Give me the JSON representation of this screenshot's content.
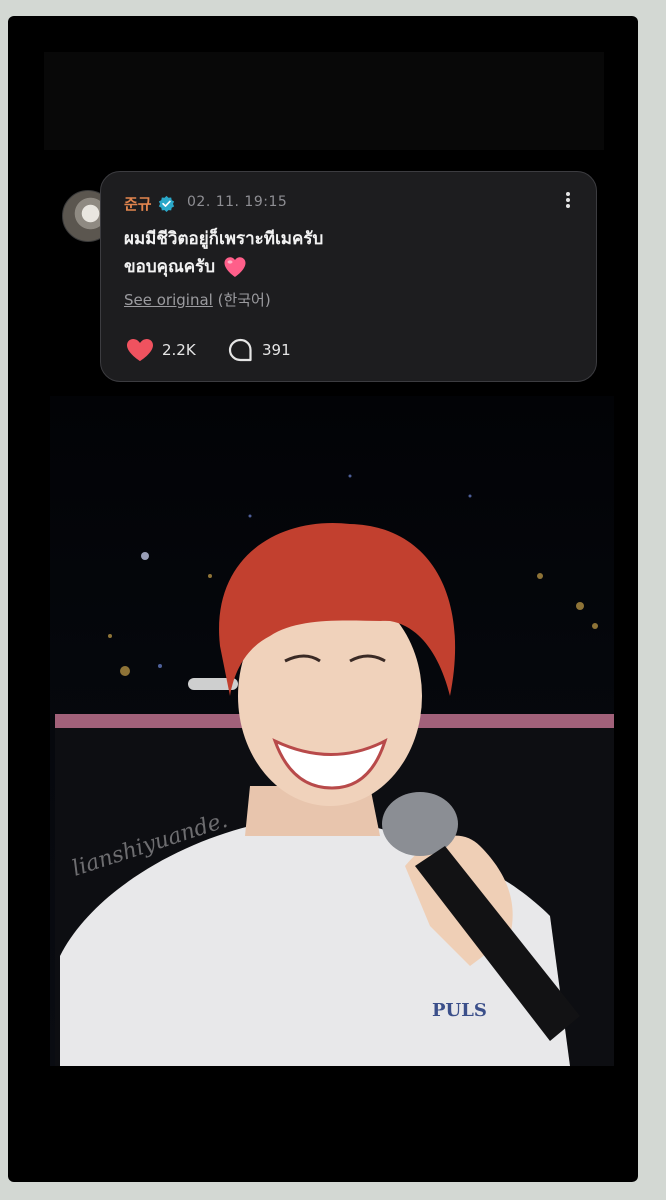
{
  "post": {
    "username": "준규",
    "timestamp": "02. 11. 19:15",
    "lines": [
      "ผมมีชีวิตอยู่ก็เพราะทีเมครับ",
      "ขอบคุณครับ"
    ],
    "see_original_label": "See original",
    "original_language": "(한국어)",
    "like_count": "2.2K",
    "comment_count": "391"
  },
  "photo": {
    "watermark": "lianshiyuande.",
    "shirt_text": "PULS"
  },
  "colors": {
    "username": "#e0844e",
    "verified": "#2aa8c9",
    "heart": "#f0525f",
    "card_bg": "#1d1d1f"
  },
  "icons": {
    "verified": "verified-badge-icon",
    "more": "more-vertical-icon",
    "like": "heart-icon",
    "comment": "comment-bubble-icon",
    "emoji": "pink-heart-emoji"
  }
}
